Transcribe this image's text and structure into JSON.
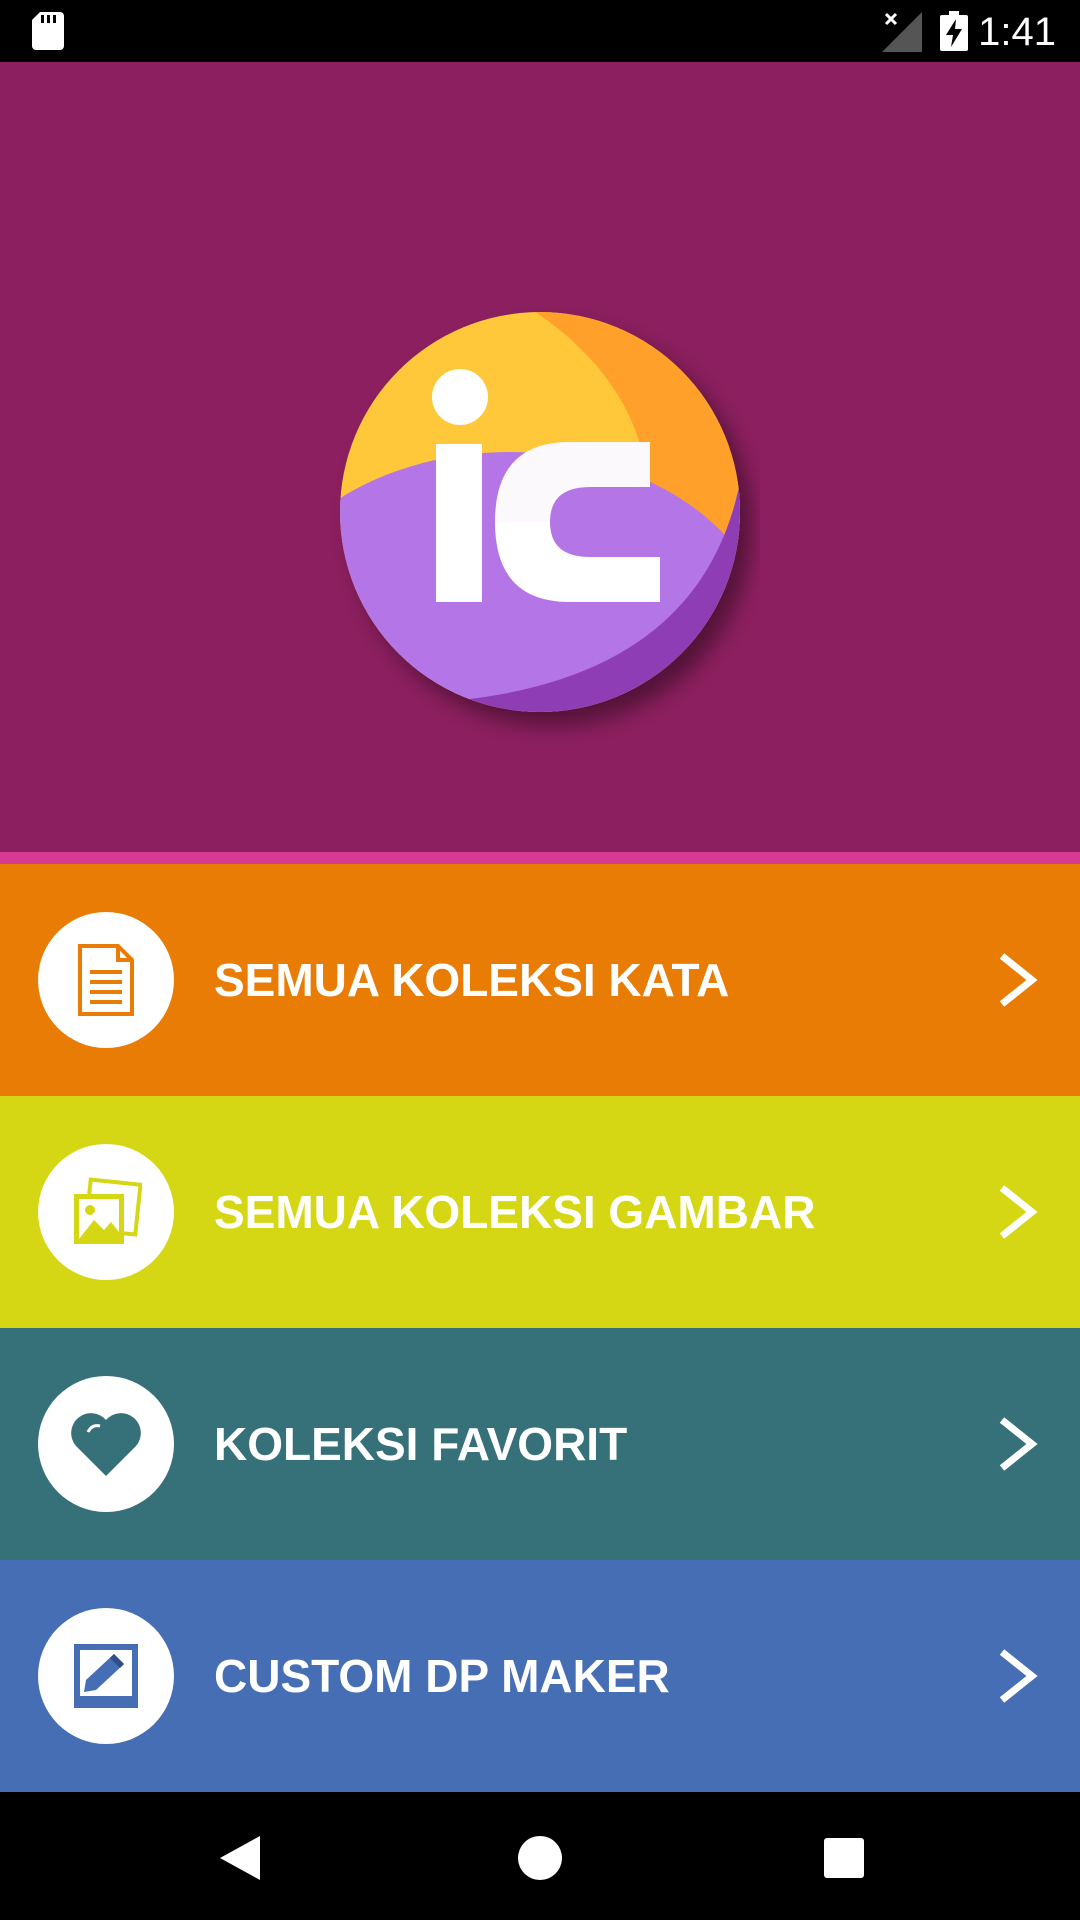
{
  "status_bar": {
    "time": "1:41",
    "icons": [
      "sd-card-icon",
      "no-sim-icon",
      "battery-charging-icon"
    ]
  },
  "header": {
    "logo_text": "iC",
    "background_color": "#8c1f5f",
    "accent_color": "#d63a92"
  },
  "menu": [
    {
      "label": "SEMUA KOLEKSI KATA",
      "icon": "document-icon",
      "color": "#e87c05"
    },
    {
      "label": "SEMUA KOLEKSI GAMBAR",
      "icon": "image-gallery-icon",
      "color": "#d6d714"
    },
    {
      "label": "KOLEKSI FAVORIT",
      "icon": "heart-icon",
      "color": "#36717a"
    },
    {
      "label": "CUSTOM DP MAKER",
      "icon": "edit-picture-icon",
      "color": "#466eb4"
    }
  ],
  "nav_bar": {
    "buttons": [
      "back-icon",
      "home-icon",
      "recents-icon"
    ]
  }
}
